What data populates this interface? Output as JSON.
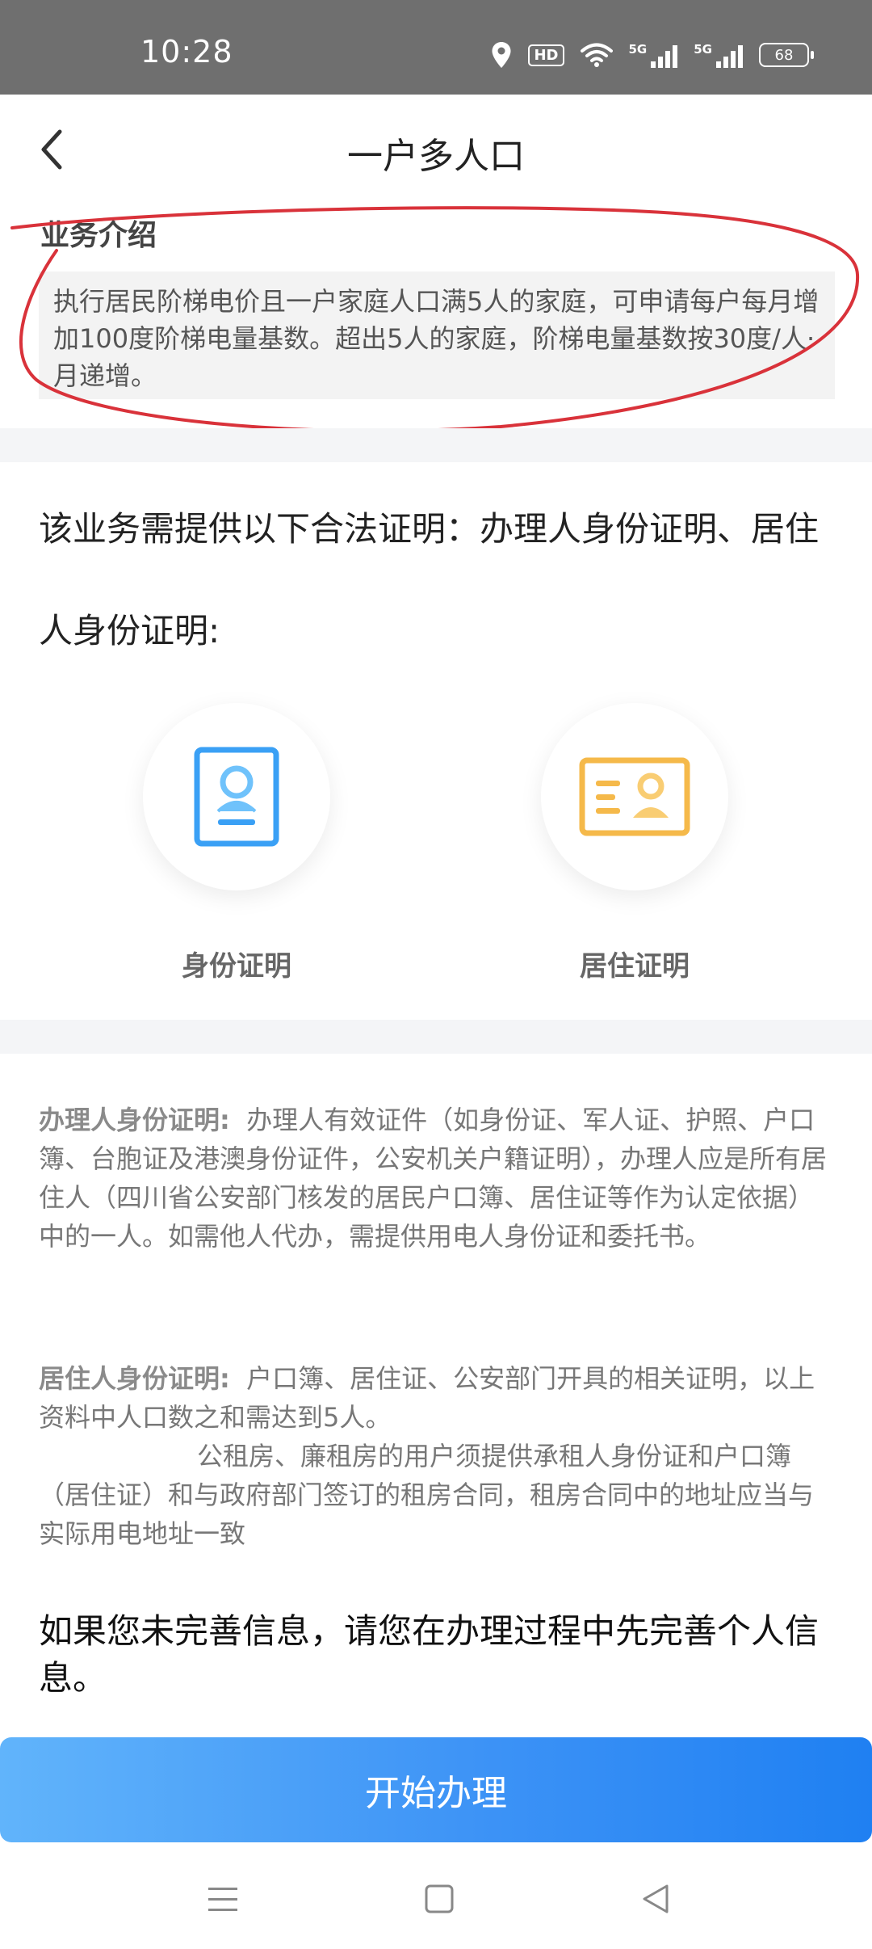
{
  "status_bar": {
    "time": "10:28",
    "icons": [
      "location-icon",
      "hd-icon",
      "wifi-icon",
      "5g-signal-icon",
      "5g-signal-icon",
      "battery-icon"
    ],
    "hd_label": "HD",
    "net_label_1": "5G",
    "net_label_2": "5G",
    "battery": "68"
  },
  "header": {
    "title": "一户多人口",
    "back_icon": "chevron-left-icon"
  },
  "intro": {
    "heading": "业务介绍",
    "body": "执行居民阶梯电价且一户家庭人口满5人的家庭，可申请每户每月增加100度阶梯电量基数。超出5人的家庭，阶梯电量基数按30度/人·月递增。",
    "annotation_color": "#d9323a"
  },
  "requirements": {
    "text": "该业务需提供以下合法证明：办理人身份证明、居住人身份证明:",
    "documents": [
      {
        "label": "身份证明",
        "icon": "id-card-icon",
        "color": "#3aa0f5"
      },
      {
        "label": "居住证明",
        "icon": "residence-card-icon",
        "color": "#f5b94a"
      }
    ]
  },
  "details": {
    "applicant_key": "办理人身份证明:",
    "applicant_text": "办理人有效证件（如身份证、军人证、护照、户口簿、台胞证及港澳身份证件，公安机关户籍证明），办理人应是所有居住人（四川省公安部门核发的居民户口簿、居住证等作为认定依据）中的一人。如需他人代办，需提供用电人身份证和委托书。",
    "resident_key": "居住人身份证明:",
    "resident_text": "户口簿、居住证、公安部门开具的相关证明，以上资料中人口数之和需达到5人。",
    "resident_extra": "公租房、廉租房的用户须提供承租人身份证和户口簿（居住证）和与政府部门签订的租房合同，租房合同中的地址应当与实际用电地址一致"
  },
  "note": "如果您未完善信息，请您在办理过程中先完善个人信息。",
  "start_button": "开始办理",
  "nav_bar": {
    "icons": [
      "menu-icon",
      "home-icon",
      "back-triangle-icon"
    ]
  }
}
